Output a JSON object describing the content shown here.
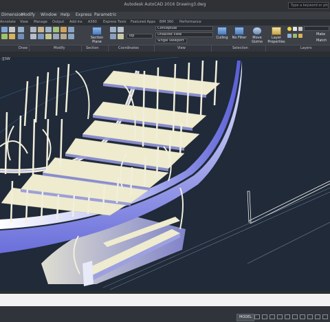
{
  "window": {
    "title": "Autodesk AutoCAD 2016   Drawing3.dwg",
    "search_placeholder": "Type a keyword or phrase"
  },
  "menu": [
    "Dimension",
    "Modify",
    "Window",
    "Help",
    "Express",
    "Parametric"
  ],
  "ribbon_tabs": [
    {
      "label": "Annotate",
      "active": false
    },
    {
      "label": "View",
      "active": false
    },
    {
      "label": "Manage",
      "active": false
    },
    {
      "label": "Output",
      "active": false
    },
    {
      "label": "Add-ins",
      "active": false
    },
    {
      "label": "A360",
      "active": false
    },
    {
      "label": "Express Tools",
      "active": false
    },
    {
      "label": "Featured Apps",
      "active": false
    },
    {
      "label": "BIM 360",
      "active": false
    },
    {
      "label": "Performance",
      "active": false
    }
  ],
  "ribbon": {
    "section_plane_label": "Section Plane",
    "view_top_label": "Top",
    "visual_style_label": "Conceptual",
    "unsaved_view_label": "Unsaved View",
    "single_viewport_label": "Single viewport",
    "culling_label": "Culling",
    "no_filter_label": "No Filter",
    "move_gizmo_label": "Move Gizmo",
    "layer_properties_label": "Layer Properties",
    "make_label": "Make",
    "match_label": "Match"
  },
  "ribbon_panels": [
    "Draw",
    "Modify",
    "Section",
    "Coordinates",
    "View",
    "Selection",
    "Layers"
  ],
  "viewport": {
    "label": "-][SW"
  },
  "statusbar": {
    "model_tab": "MODEL"
  },
  "colors": {
    "viewport_background": "#202a38",
    "stair_face": "#efebcf",
    "stringer_gradient_start": "#ffffff",
    "stringer_gradient_end": "#5a5fd6"
  }
}
